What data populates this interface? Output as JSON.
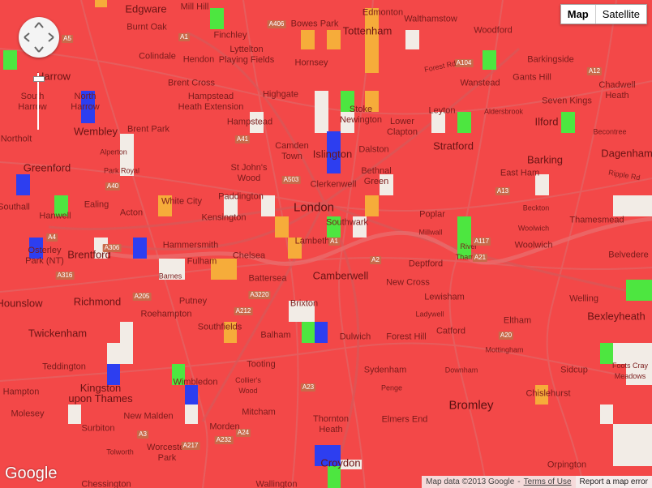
{
  "map": {
    "colors": {
      "base": "#f34848",
      "road": "#e86060",
      "major_road": "#d65050",
      "blue": "#2d3ef0",
      "green": "#4de640",
      "orange": "#f6ac3a",
      "white": "#f2ece6"
    },
    "places": [
      {
        "id": "edgware",
        "label": "Edgware",
        "kind": "major"
      },
      {
        "id": "mill-hill",
        "label": "Mill Hill",
        "kind": "normal"
      },
      {
        "id": "burnt-oak",
        "label": "Burnt Oak",
        "kind": "normal"
      },
      {
        "id": "finchley",
        "label": "Finchley",
        "kind": "normal"
      },
      {
        "id": "bowes-park",
        "label": "Bowes Park",
        "kind": "normal"
      },
      {
        "id": "edmonton",
        "label": "Edmonton",
        "kind": "normal"
      },
      {
        "id": "walthamstow",
        "label": "Walthamstow",
        "kind": "normal"
      },
      {
        "id": "tottenham",
        "label": "Tottenham",
        "kind": "major"
      },
      {
        "id": "woodford",
        "label": "Woodford",
        "kind": "normal"
      },
      {
        "id": "colindale",
        "label": "Colindale",
        "kind": "normal"
      },
      {
        "id": "hendon",
        "label": "Hendon",
        "kind": "normal"
      },
      {
        "id": "lyttelton",
        "label": "Lyttelton\nPlaying Fields",
        "kind": "normal"
      },
      {
        "id": "hornsey",
        "label": "Hornsey",
        "kind": "normal"
      },
      {
        "id": "barkingside",
        "label": "Barkingside",
        "kind": "normal"
      },
      {
        "id": "harrow",
        "label": "Harrow",
        "kind": "major"
      },
      {
        "id": "wanstead",
        "label": "Wanstead",
        "kind": "normal"
      },
      {
        "id": "gants-hill",
        "label": "Gants Hill",
        "kind": "normal"
      },
      {
        "id": "brent-cross",
        "label": "Brent Cross",
        "kind": "normal"
      },
      {
        "id": "south-harrow",
        "label": "South\nHarrow",
        "kind": "normal"
      },
      {
        "id": "north-harrow",
        "label": "North\nHarrow",
        "kind": "normal"
      },
      {
        "id": "hampstead-heath",
        "label": "Hampstead\nHeath Extension",
        "kind": "normal"
      },
      {
        "id": "highgate",
        "label": "Highgate",
        "kind": "normal"
      },
      {
        "id": "stoke-newington",
        "label": "Stoke\nNewington",
        "kind": "normal"
      },
      {
        "id": "leyton",
        "label": "Leyton",
        "kind": "normal"
      },
      {
        "id": "aldersbrook",
        "label": "Aldersbrook",
        "kind": "small"
      },
      {
        "id": "seven-kings",
        "label": "Seven Kings",
        "kind": "normal"
      },
      {
        "id": "chadwell-heath",
        "label": "Chadwell\nHeath",
        "kind": "normal"
      },
      {
        "id": "wembley",
        "label": "Wembley",
        "kind": "major"
      },
      {
        "id": "brent-park",
        "label": "Brent Park",
        "kind": "normal"
      },
      {
        "id": "hampstead",
        "label": "Hampstead",
        "kind": "normal"
      },
      {
        "id": "lower-clapton",
        "label": "Lower\nClapton",
        "kind": "normal"
      },
      {
        "id": "ilford",
        "label": "Ilford",
        "kind": "major"
      },
      {
        "id": "becontree",
        "label": "Becontree",
        "kind": "small"
      },
      {
        "id": "northolt",
        "label": "Northolt",
        "kind": "normal"
      },
      {
        "id": "alperton",
        "label": "Alperton",
        "kind": "small"
      },
      {
        "id": "camden-town",
        "label": "Camden\nTown",
        "kind": "normal"
      },
      {
        "id": "islington",
        "label": "Islington",
        "kind": "major"
      },
      {
        "id": "dalston",
        "label": "Dalston",
        "kind": "normal"
      },
      {
        "id": "stratford",
        "label": "Stratford",
        "kind": "major"
      },
      {
        "id": "dagenham",
        "label": "Dagenham",
        "kind": "major"
      },
      {
        "id": "greenford",
        "label": "Greenford",
        "kind": "major"
      },
      {
        "id": "park-royal",
        "label": "Park Royal",
        "kind": "small"
      },
      {
        "id": "st-johns-wood",
        "label": "St John's\nWood",
        "kind": "normal"
      },
      {
        "id": "bethnal-green",
        "label": "Bethnal\nGreen",
        "kind": "normal"
      },
      {
        "id": "barking",
        "label": "Barking",
        "kind": "major"
      },
      {
        "id": "east-ham",
        "label": "East Ham",
        "kind": "normal"
      },
      {
        "id": "clerkenwell",
        "label": "Clerkenwell",
        "kind": "normal"
      },
      {
        "id": "white-city",
        "label": "White City",
        "kind": "normal"
      },
      {
        "id": "paddington",
        "label": "Paddington",
        "kind": "normal"
      },
      {
        "id": "london",
        "label": "London",
        "kind": "city"
      },
      {
        "id": "southall",
        "label": "Southall",
        "kind": "normal"
      },
      {
        "id": "ealing",
        "label": "Ealing",
        "kind": "normal"
      },
      {
        "id": "hanwell",
        "label": "Hanwell",
        "kind": "normal"
      },
      {
        "id": "acton",
        "label": "Acton",
        "kind": "normal"
      },
      {
        "id": "kensington",
        "label": "Kensington",
        "kind": "normal"
      },
      {
        "id": "poplar",
        "label": "Poplar",
        "kind": "normal"
      },
      {
        "id": "beckton",
        "label": "Beckton",
        "kind": "small"
      },
      {
        "id": "woolwich-ferry",
        "label": "Woolwich",
        "kind": "small"
      },
      {
        "id": "thamesmead",
        "label": "Thamesmead",
        "kind": "normal"
      },
      {
        "id": "southwark",
        "label": "Southwark",
        "kind": "normal"
      },
      {
        "id": "millwall",
        "label": "Millwall",
        "kind": "small"
      },
      {
        "id": "lambeth",
        "label": "Lambeth",
        "kind": "normal"
      },
      {
        "id": "hammersmith",
        "label": "Hammersmith",
        "kind": "normal"
      },
      {
        "id": "osterley",
        "label": "Osterley\nPark (NT)",
        "kind": "normal"
      },
      {
        "id": "brentford",
        "label": "Brentford",
        "kind": "major"
      },
      {
        "id": "fulham",
        "label": "Fulham",
        "kind": "normal"
      },
      {
        "id": "chelsea",
        "label": "Chelsea",
        "kind": "normal"
      },
      {
        "id": "woolwich",
        "label": "Woolwich",
        "kind": "normal"
      },
      {
        "id": "belvedere",
        "label": "Belvedere",
        "kind": "normal"
      },
      {
        "id": "river-thames",
        "label": "River\nThames",
        "kind": "small"
      },
      {
        "id": "deptford",
        "label": "Deptford",
        "kind": "normal"
      },
      {
        "id": "barnes",
        "label": "Barnes",
        "kind": "small"
      },
      {
        "id": "battersea",
        "label": "Battersea",
        "kind": "normal"
      },
      {
        "id": "camberwell",
        "label": "Camberwell",
        "kind": "major"
      },
      {
        "id": "new-cross",
        "label": "New Cross",
        "kind": "normal"
      },
      {
        "id": "hounslow",
        "label": "Hounslow",
        "kind": "major"
      },
      {
        "id": "richmond",
        "label": "Richmond",
        "kind": "major"
      },
      {
        "id": "putney",
        "label": "Putney",
        "kind": "normal"
      },
      {
        "id": "lewisham",
        "label": "Lewisham",
        "kind": "normal"
      },
      {
        "id": "welling",
        "label": "Welling",
        "kind": "normal"
      },
      {
        "id": "roehampton",
        "label": "Roehampton",
        "kind": "normal"
      },
      {
        "id": "brixton",
        "label": "Brixton",
        "kind": "normal"
      },
      {
        "id": "ladywell",
        "label": "Ladywell",
        "kind": "small"
      },
      {
        "id": "bexleyheath",
        "label": "Bexleyheath",
        "kind": "major"
      },
      {
        "id": "eltham",
        "label": "Eltham",
        "kind": "normal"
      },
      {
        "id": "twickenham",
        "label": "Twickenham",
        "kind": "major"
      },
      {
        "id": "southfields",
        "label": "Southfields",
        "kind": "normal"
      },
      {
        "id": "balham",
        "label": "Balham",
        "kind": "normal"
      },
      {
        "id": "dulwich",
        "label": "Dulwich",
        "kind": "normal"
      },
      {
        "id": "forest-hill",
        "label": "Forest Hill",
        "kind": "normal"
      },
      {
        "id": "catford",
        "label": "Catford",
        "kind": "normal"
      },
      {
        "id": "mottingham",
        "label": "Mottingham",
        "kind": "small"
      },
      {
        "id": "teddington",
        "label": "Teddington",
        "kind": "normal"
      },
      {
        "id": "tooting",
        "label": "Tooting",
        "kind": "normal"
      },
      {
        "id": "sydenham",
        "label": "Sydenham",
        "kind": "normal"
      },
      {
        "id": "downham",
        "label": "Downham",
        "kind": "small"
      },
      {
        "id": "sidcup",
        "label": "Sidcup",
        "kind": "normal"
      },
      {
        "id": "kingston",
        "label": "Kingston\nupon Thames",
        "kind": "major"
      },
      {
        "id": "wimbledon",
        "label": "Wimbledon",
        "kind": "normal"
      },
      {
        "id": "colliers-wood",
        "label": "Collier's\nWood",
        "kind": "small"
      },
      {
        "id": "penge",
        "label": "Penge",
        "kind": "small"
      },
      {
        "id": "foots-cray",
        "label": "Foots Cray\nMeadows",
        "kind": "small"
      },
      {
        "id": "hampton",
        "label": "Hampton",
        "kind": "normal"
      },
      {
        "id": "chislehurst",
        "label": "Chislehurst",
        "kind": "normal"
      },
      {
        "id": "molesey",
        "label": "Molesey",
        "kind": "normal"
      },
      {
        "id": "new-malden",
        "label": "New Malden",
        "kind": "normal"
      },
      {
        "id": "mitcham",
        "label": "Mitcham",
        "kind": "normal"
      },
      {
        "id": "bromley",
        "label": "Bromley",
        "kind": "city"
      },
      {
        "id": "surbiton",
        "label": "Surbiton",
        "kind": "normal"
      },
      {
        "id": "morden",
        "label": "Morden",
        "kind": "normal"
      },
      {
        "id": "thornton-heath",
        "label": "Thornton\nHeath",
        "kind": "normal"
      },
      {
        "id": "elmers-end",
        "label": "Elmers End",
        "kind": "normal"
      },
      {
        "id": "worcester-park",
        "label": "Worcester\nPark",
        "kind": "normal"
      },
      {
        "id": "tolworth",
        "label": "Tolworth",
        "kind": "small"
      },
      {
        "id": "croydon",
        "label": "Croydon",
        "kind": "major"
      },
      {
        "id": "orpington",
        "label": "Orpington",
        "kind": "normal"
      },
      {
        "id": "chessington",
        "label": "Chessington",
        "kind": "normal"
      },
      {
        "id": "wallington",
        "label": "Wallington",
        "kind": "normal"
      }
    ],
    "roads": [
      "A406",
      "A1",
      "A5",
      "A41",
      "A503",
      "A1",
      "A104",
      "A12",
      "A4",
      "A3220",
      "A205",
      "A24",
      "A23",
      "A2",
      "A21",
      "A20",
      "A13",
      "A117",
      "A316",
      "A306",
      "A3",
      "A217",
      "A232",
      "A212",
      "A40"
    ],
    "controls": {
      "map_label": "Map",
      "satellite_label": "Satellite",
      "forest_rd": "Forest Rd",
      "ripple_rd": "Ripple Rd"
    },
    "attribution": {
      "logo": "Google",
      "data": "Map data ©2013 Google",
      "separator": "-",
      "terms": "Terms of Use",
      "report": "Report a map error"
    }
  }
}
